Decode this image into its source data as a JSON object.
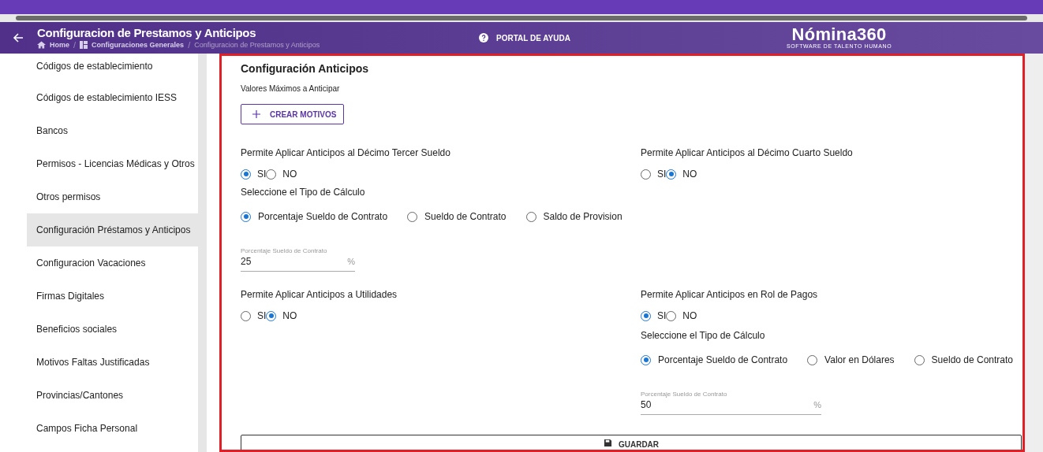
{
  "header": {
    "title": "Configuracion de Prestamos y Anticipos",
    "breadcrumbs": [
      {
        "label": "Home",
        "kind": "home"
      },
      {
        "separator": "/",
        "label": "Configuraciones Generales",
        "kind": "grid"
      },
      {
        "separator": "/",
        "label": "Configuracion de Prestamos y Anticipos",
        "kind": "current"
      }
    ],
    "help": "PORTAL DE AYUDA",
    "logo": {
      "name": "Nómina360",
      "tagline": "SOFTWARE DE TALENTO HUMANO"
    }
  },
  "sidebar": {
    "items": [
      {
        "label": "Códigos de establecimiento",
        "selected": false
      },
      {
        "label": "Códigos de establecimiento IESS",
        "selected": false
      },
      {
        "label": "Bancos",
        "selected": false
      },
      {
        "label": "Permisos - Licencias Médicas y Otros",
        "selected": false
      },
      {
        "label": "Otros permisos",
        "selected": false
      },
      {
        "label": "Configuración Préstamos y Anticipos",
        "selected": true
      },
      {
        "label": "Configuracion Vacaciones",
        "selected": false
      },
      {
        "label": "Firmas Digitales",
        "selected": false
      },
      {
        "label": "Beneficios sociales",
        "selected": false
      },
      {
        "label": "Motivos Faltas Justificadas",
        "selected": false
      },
      {
        "label": "Provincias/Cantones",
        "selected": false
      },
      {
        "label": "Campos Ficha Personal",
        "selected": false
      }
    ]
  },
  "panel": {
    "title": "Configuración Anticipos",
    "subtitle": "Valores Máximos a Anticipar",
    "create_button": "CREAR MOTIVOS",
    "rows": [
      {
        "left": [
          {
            "kind": "radio",
            "label": "Permite Aplicar Anticipos al Décimo Tercer Sueldo",
            "options": [
              {
                "label": "SI",
                "selected": true
              },
              {
                "label": "NO",
                "selected": false
              }
            ]
          },
          {
            "kind": "radio",
            "label": "Seleccione el Tipo de Cálculo",
            "options": [
              {
                "label": "Porcentaje Sueldo de Contrato",
                "selected": true
              },
              {
                "label": "Sueldo de Contrato",
                "selected": false
              },
              {
                "label": "Saldo de Provision",
                "selected": false
              }
            ]
          },
          {
            "kind": "field",
            "label": "Porcentaje Sueldo de Contrato",
            "value": "25",
            "suffix": "%"
          }
        ],
        "right": [
          {
            "kind": "radio",
            "label": "Permite Aplicar Anticipos al Décimo Cuarto Sueldo",
            "options": [
              {
                "label": "SI",
                "selected": false
              },
              {
                "label": "NO",
                "selected": true
              }
            ]
          }
        ]
      },
      {
        "left": [
          {
            "kind": "radio",
            "label": "Permite Aplicar Anticipos a Utilidades",
            "options": [
              {
                "label": "SI",
                "selected": false
              },
              {
                "label": "NO",
                "selected": true
              }
            ]
          }
        ],
        "right": [
          {
            "kind": "radio",
            "label": "Permite Aplicar Anticipos en Rol de Pagos",
            "options": [
              {
                "label": "SI",
                "selected": true
              },
              {
                "label": "NO",
                "selected": false
              }
            ]
          },
          {
            "kind": "radio",
            "label": "Seleccione el Tipo de Cálculo",
            "options": [
              {
                "label": "Porcentaje Sueldo de Contrato",
                "selected": true
              },
              {
                "label": "Valor en Dólares",
                "selected": false
              },
              {
                "label": "Sueldo de Contrato",
                "selected": false
              }
            ]
          },
          {
            "kind": "field",
            "label": "Porcentaje Sueldo de Contrato",
            "value": "50",
            "suffix": "%"
          }
        ]
      }
    ],
    "save_button": "GUARDAR"
  }
}
